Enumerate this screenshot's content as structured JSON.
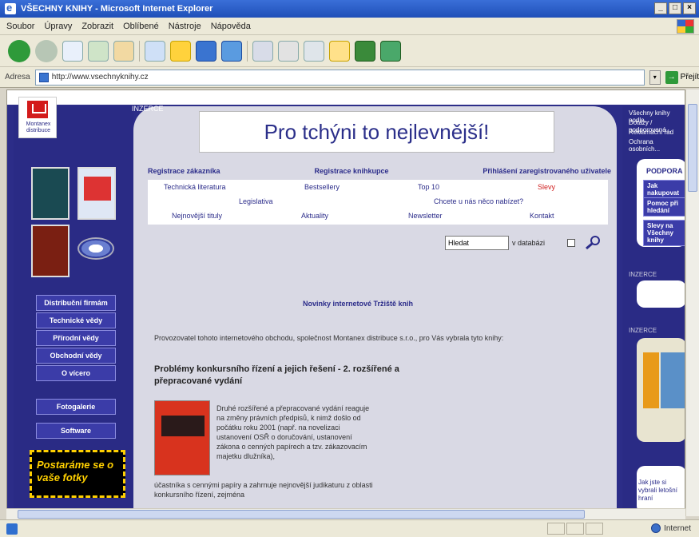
{
  "window": {
    "title": "VŠECHNY KNIHY - Microsoft Internet Explorer",
    "controls": [
      "_",
      "□",
      "×"
    ]
  },
  "menu": [
    "Soubor",
    "Úpravy",
    "Zobrazit",
    "Oblíbené",
    "Nástroje",
    "Nápověda"
  ],
  "address": {
    "label": "Adresa",
    "url": "http://www.vsechnyknihy.cz",
    "go_label": "Přejít"
  },
  "status": {
    "zone": "Internet"
  },
  "page": {
    "logo_text": "Montanex distribuce",
    "inzerce_label": "INZERCE",
    "banner_text": "Pro tchýni to nejlevnější!",
    "categories": [
      "Registrace zákazníka",
      "Registrace knihkupce",
      "Přihlášení zaregistrovaného uživatele"
    ],
    "links": {
      "row1": [
        "Technická literatura",
        "Bestsellery",
        "Top 10",
        "Slevy"
      ],
      "row2": [
        "Legislativa",
        "Chcete u nás něco nabízet?"
      ],
      "row3": [
        "Nejnovější tituly",
        "Aktuality",
        "Newsletter",
        "Kontakt"
      ]
    },
    "search": {
      "value": "Hledat",
      "checkbox_label": "v databázi"
    },
    "left_nav": [
      "Distribuční firmám",
      "Technické vědy",
      "Přírodní vědy",
      "Obchodní vědy",
      "O vícero",
      "Fotogalerie",
      "Software"
    ],
    "promo_text": "Postaráme se o vaše fotky",
    "news_heading": "Novinky internetové Tržiště knih",
    "intro_text": "Provozovatel tohoto internetového obchodu, společnost Montanex distribuce s.r.o., pro Vás vybrala tyto knihy:",
    "article_title": "Problémy konkursního řízení a jejich řešení - 2. rozšířené a přepracované vydání",
    "article_body": "Druhé rozšířené a přepracované vydání reaguje na změny právních předpisů, k nimž došlo od počátku roku 2001 (např. na novelizaci ustanovení OSŘ o doručování, ustanovení zákona o cenných papírech a tzv. zákazovacím majetku dlužníka),",
    "article_body2": "účastníka s cennými papíry a zahrnuje nejnovější judikaturu z oblasti konkursního řízení, zejména",
    "right_links": [
      "Všechny knihy podle...",
      "Dotazy / podporovaná...",
      "Reklamační řád",
      "Ochrana osobních..."
    ],
    "right_heading": "PODPORA",
    "right_buttons": [
      "Jak nakupovat",
      "Pomoc při hledání",
      "Slevy na Všechny knihy"
    ],
    "right_small": [
      "INZERCE",
      "INZERCE"
    ],
    "right_bottom_text": "Jak jste si vybrali letošní hraní",
    "colors": {
      "page_bg": "#2c2d88",
      "content_bg": "#d9d9e4",
      "accent_red": "#d02020",
      "link_blue": "#2b2c8a"
    }
  }
}
